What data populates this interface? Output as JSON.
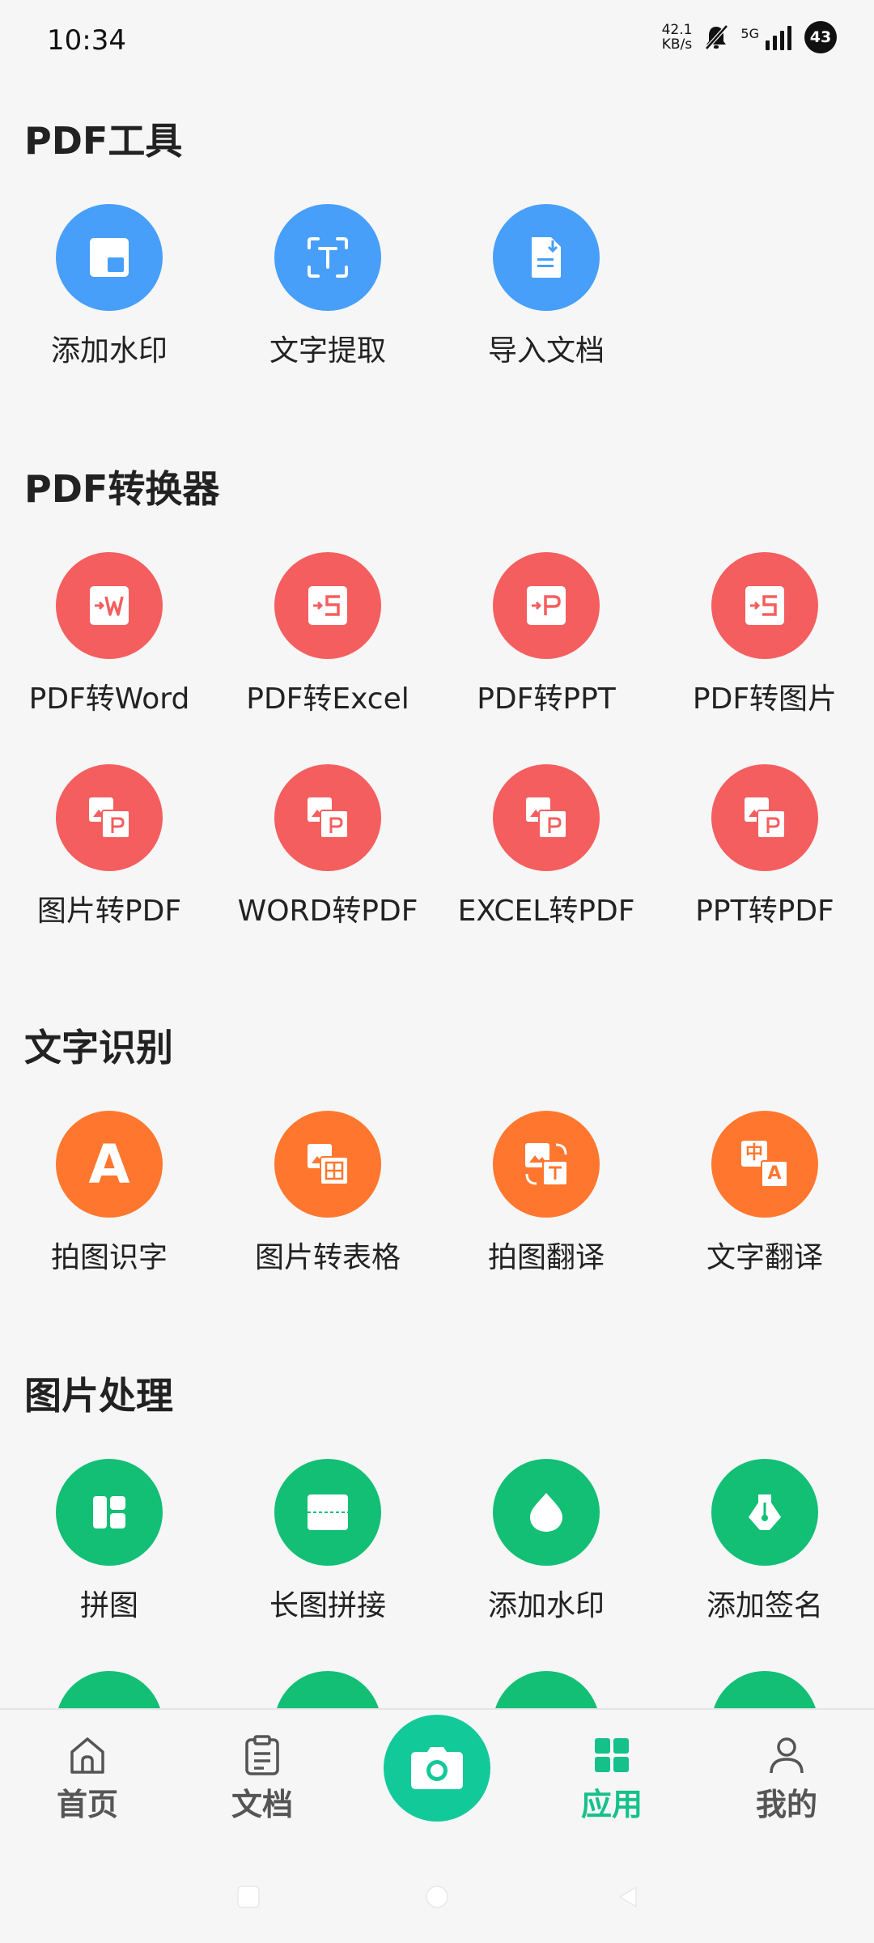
{
  "status_bar": {
    "time": "10:34",
    "net_speed_value": "42.1",
    "net_speed_unit": "KB/s",
    "network_type": "5G",
    "battery": "43",
    "icons": [
      "mute-icon",
      "signal-icon"
    ]
  },
  "sections": [
    {
      "title": "PDF工具",
      "color": "#479ffa",
      "tools": [
        {
          "label": "添加水印",
          "icon": "watermark-icon"
        },
        {
          "label": "文字提取",
          "icon": "text-extract-icon"
        },
        {
          "label": "导入文档",
          "icon": "import-document-icon"
        }
      ]
    },
    {
      "title": "PDF转换器",
      "color": "#f55e5e",
      "tools": [
        {
          "label": "PDF转Word",
          "icon": "pdf-to-word-icon"
        },
        {
          "label": "PDF转Excel",
          "icon": "pdf-to-excel-icon"
        },
        {
          "label": "PDF转PPT",
          "icon": "pdf-to-ppt-icon"
        },
        {
          "label": "PDF转图片",
          "icon": "pdf-to-image-icon"
        },
        {
          "label": "图片转PDF",
          "icon": "image-to-pdf-icon"
        },
        {
          "label": "WORD转PDF",
          "icon": "word-to-pdf-icon"
        },
        {
          "label": "EXCEL转PDF",
          "icon": "excel-to-pdf-icon"
        },
        {
          "label": "PPT转PDF",
          "icon": "ppt-to-pdf-icon"
        }
      ]
    },
    {
      "title": "文字识别",
      "color": "#ff772e",
      "tools": [
        {
          "label": "拍图识字",
          "icon": "photo-text-recognition-icon",
          "glyph": "A"
        },
        {
          "label": "图片转表格",
          "icon": "image-to-table-icon"
        },
        {
          "label": "拍图翻译",
          "icon": "photo-translate-icon"
        },
        {
          "label": "文字翻译",
          "icon": "text-translate-icon",
          "glyph_main": "中",
          "glyph_sub": "A"
        }
      ]
    },
    {
      "title": "图片处理",
      "color": "#12bf75",
      "tools": [
        {
          "label": "拼图",
          "icon": "collage-icon"
        },
        {
          "label": "长图拼接",
          "icon": "long-image-stitch-icon"
        },
        {
          "label": "添加水印",
          "icon": "image-watermark-icon"
        },
        {
          "label": "添加签名",
          "icon": "signature-icon"
        }
      ]
    }
  ],
  "bottom_nav": {
    "items": [
      {
        "label": "首页",
        "icon": "home-icon"
      },
      {
        "label": "文档",
        "icon": "document-icon"
      },
      {
        "label": "应用",
        "icon": "apps-icon",
        "active": true
      },
      {
        "label": "我的",
        "icon": "profile-icon"
      }
    ],
    "camera_icon": "camera-icon",
    "accent": "#16c08a",
    "fab_color": "#12c99a"
  }
}
